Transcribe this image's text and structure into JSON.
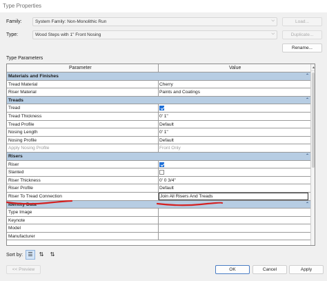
{
  "window": {
    "title": "Type Properties"
  },
  "family": {
    "label": "Family:",
    "value": "System Family: Non-Monolithic Run",
    "load_label": "Load..."
  },
  "type": {
    "label": "Type:",
    "value": "Wood Steps with 1\" Front Nosing",
    "duplicate_label": "Duplicate...",
    "rename_label": "Rename..."
  },
  "type_parameters": {
    "label": "Type Parameters",
    "headers": {
      "parameter": "Parameter",
      "value": "Value"
    },
    "groups": [
      {
        "name": "Materials and Finishes",
        "rows": [
          {
            "param": "Tread Material",
            "value": "Cherry"
          },
          {
            "param": "Riser Material",
            "value": "Paints and Coatings"
          }
        ]
      },
      {
        "name": "Treads",
        "rows": [
          {
            "param": "Tread",
            "checkbox": true
          },
          {
            "param": "Tread Thickness",
            "value": "0'  1\""
          },
          {
            "param": "Tread Profile",
            "value": "Default"
          },
          {
            "param": "Nosing Length",
            "value": "0'  1\""
          },
          {
            "param": "Nosing Profile",
            "value": "Default"
          },
          {
            "param": "Apply Nosing Profile",
            "value": "Front Only",
            "disabled": true
          }
        ]
      },
      {
        "name": "Risers",
        "rows": [
          {
            "param": "Riser",
            "checkbox": true
          },
          {
            "param": "Slanted",
            "checkbox": false
          },
          {
            "param": "Riser Thickness",
            "value": "0'  0 3/4\""
          },
          {
            "param": "Riser Profile",
            "value": "Default"
          },
          {
            "param": "Riser To Tread Connection",
            "value": "Join All Risers And Treads",
            "selected": true
          }
        ]
      },
      {
        "name": "Identity Data",
        "rows": [
          {
            "param": "Type Image",
            "value": ""
          },
          {
            "param": "Keynote",
            "value": ""
          },
          {
            "param": "Model",
            "value": ""
          },
          {
            "param": "Manufacturer",
            "value": ""
          }
        ]
      }
    ],
    "group_collapse_icon": "double-chevron-up-icon"
  },
  "sort": {
    "label": "Sort by:",
    "icons": [
      "group-sort-icon",
      "sort-ascending-icon",
      "sort-descending-icon"
    ]
  },
  "footer": {
    "preview_label": "<< Preview",
    "ok_label": "OK",
    "cancel_label": "Cancel",
    "apply_label": "Apply"
  },
  "annotation_color": "#d42020"
}
